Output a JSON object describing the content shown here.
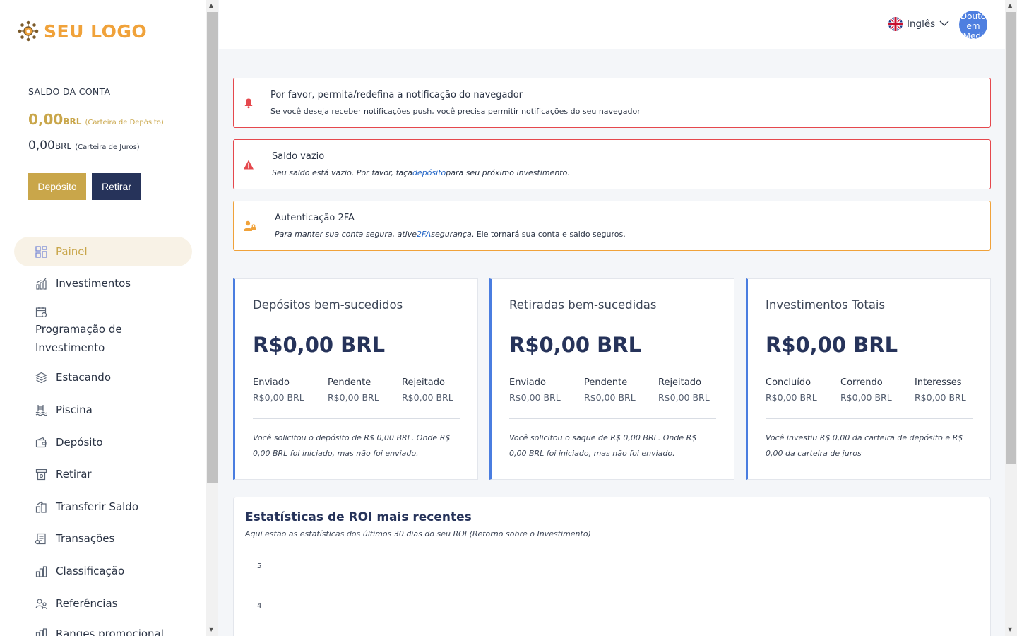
{
  "sidebar": {
    "logo_text": "SEU LOGO",
    "balance_title": "SALDO DA CONTA",
    "deposit_wallet": {
      "amount": "0,00",
      "currency": "BRL",
      "note": "(Carteira de Depósito)"
    },
    "interest_wallet": {
      "amount": "0,00",
      "currency": "BRL",
      "note": "(Carteira de Juros)"
    },
    "deposit_button": "Depósito",
    "withdraw_button": "Retirar",
    "nav": [
      {
        "label": "Painel",
        "icon": "dashboard-icon",
        "active": true
      },
      {
        "label": "Investimentos",
        "icon": "investments-icon"
      },
      {
        "label_line1": "Programação de",
        "label_line2": "Investimento",
        "icon": "calendar-icon"
      },
      {
        "label": "Estacando",
        "icon": "layers-icon"
      },
      {
        "label": "Piscina",
        "icon": "pool-icon"
      },
      {
        "label": "Depósito",
        "icon": "wallet-icon"
      },
      {
        "label": "Retirar",
        "icon": "atm-icon"
      },
      {
        "label": "Transferir Saldo",
        "icon": "transfer-icon"
      },
      {
        "label": "Transações",
        "icon": "transactions-icon"
      },
      {
        "label": "Classificação",
        "icon": "ranking-icon"
      },
      {
        "label": "Referências",
        "icon": "referrals-icon"
      },
      {
        "label": "Ranges promocional",
        "icon": "promo-icon"
      }
    ]
  },
  "header": {
    "language": "Inglês",
    "avatar_text": "Douto em Medi"
  },
  "alerts": [
    {
      "title": "Por favor, permita/redefina a notificação do navegador",
      "text": "Se você deseja receber notificações push, você precisa permitir notificações do seu navegador",
      "color": "#e5484d"
    },
    {
      "title": "Saldo vazio",
      "text_before": "Seu saldo está vazio. Por favor, faça",
      "link": "depósito",
      "text_after": "para seu próximo investimento.",
      "color": "#e5484d"
    },
    {
      "title": "Autenticação 2FA",
      "text_before": "Para manter sua conta segura, ative",
      "link": "2FA",
      "text_mid": "segurança",
      "text_after": ". Ele tornará sua conta e saldo seguros.",
      "color": "#f0a23a"
    }
  ],
  "cards": [
    {
      "title": "Depósitos bem-sucedidos",
      "value": "R$0,00 BRL",
      "cols": [
        {
          "label": "Enviado",
          "value": "R$0,00 BRL"
        },
        {
          "label": "Pendente",
          "value": "R$0,00 BRL"
        },
        {
          "label": "Rejeitado",
          "value": "R$0,00 BRL"
        }
      ],
      "note": "Você solicitou o depósito de R$ 0,00 BRL. Onde R$ 0,00 BRL foi iniciado, mas não foi enviado."
    },
    {
      "title": "Retiradas bem-sucedidas",
      "value": "R$0,00 BRL",
      "cols": [
        {
          "label": "Enviado",
          "value": "R$0,00 BRL"
        },
        {
          "label": "Pendente",
          "value": "R$0,00 BRL"
        },
        {
          "label": "Rejeitado",
          "value": "R$0,00 BRL"
        }
      ],
      "note": "Você solicitou o saque de R$ 0,00 BRL. Onde R$ 0,00 BRL foi iniciado, mas não foi enviado."
    },
    {
      "title": "Investimentos Totais",
      "value": "R$0,00 BRL",
      "cols": [
        {
          "label": "Concluído",
          "value": "R$0,00 BRL"
        },
        {
          "label": "Correndo",
          "value": "R$0,00 BRL"
        },
        {
          "label": "Interesses",
          "value": "R$0,00 BRL"
        }
      ],
      "note": "Você investiu R$ 0,00 da carteira de depósito e R$ 0,00 da carteira de juros"
    }
  ],
  "roi": {
    "title": "Estatísticas de ROI mais recentes",
    "subtitle": "Aqui estão as estatísticas dos últimos 30 dias do seu ROI (Retorno sobre o Investimento)",
    "y_ticks": [
      "5",
      "4"
    ]
  },
  "colors": {
    "gold": "#c9a64a",
    "navy": "#26335a",
    "accent_blue": "#4a7de0",
    "logo_orange": "#f0a23a"
  }
}
